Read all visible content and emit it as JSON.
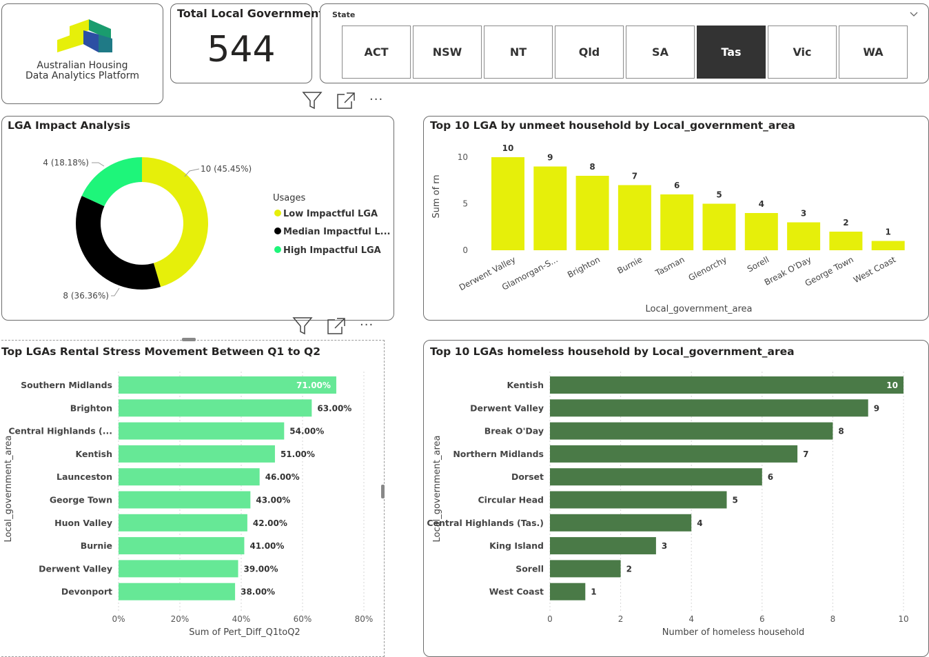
{
  "logo": {
    "line1": "Australian Housing",
    "line2": "Data Analytics Platform"
  },
  "kpi": {
    "title": "Total Local Government",
    "value": "544"
  },
  "slicer": {
    "title": "State",
    "options": [
      "ACT",
      "NSW",
      "NT",
      "Qld",
      "SA",
      "Tas",
      "Vic",
      "WA"
    ],
    "selected": "Tas"
  },
  "icons": [
    "filter-icon",
    "focus-mode-icon",
    "more-options-icon",
    "chevron-down-icon"
  ],
  "donut": {
    "title": "LGA Impact Analysis",
    "legend_title": "Usages",
    "slices": [
      {
        "name": "Low Impactful LGA",
        "value": 10,
        "label": "10 (45.45%)",
        "color": "#e6ef0a"
      },
      {
        "name": "Median Impactful L...",
        "value": 8,
        "label": "8 (36.36%)",
        "color": "#000000"
      },
      {
        "name": "High Impactful LGA",
        "value": 4,
        "label": "4 (18.18%)",
        "color": "#1ef57a"
      }
    ]
  },
  "chart_data": [
    {
      "type": "bar",
      "title": "Top 10 LGA by unmeet household by Local_government_area",
      "xlabel": "Local_government_area",
      "ylabel": "Sum of rn",
      "categories": [
        "Derwent Valley",
        "Glamorgan-S...",
        "Brighton",
        "Burnie",
        "Tasman",
        "Glenorchy",
        "Sorell",
        "Break O'Day",
        "George Town",
        "West Coast"
      ],
      "values": [
        10,
        9,
        8,
        7,
        6,
        5,
        4,
        3,
        2,
        1
      ],
      "yticks": [
        "0",
        "5",
        "10"
      ],
      "ylim": [
        0,
        10
      ],
      "color": "#e6ef0a",
      "grid": false
    },
    {
      "type": "bar",
      "orientation": "horizontal",
      "title": "Top LGAs Rental Stress Movement Between Q1 to Q2",
      "xlabel": "Sum of Pert_Diff_Q1toQ2",
      "ylabel": "Local_government_area",
      "categories": [
        "Southern Midlands",
        "Brighton",
        "Central Highlands (...",
        "Kentish",
        "Launceston",
        "George Town",
        "Huon Valley",
        "Burnie",
        "Derwent Valley",
        "Devonport"
      ],
      "values": [
        71,
        63,
        54,
        51,
        46,
        43,
        42,
        41,
        39,
        38
      ],
      "data_labels": [
        "71.00%",
        "63.00%",
        "54.00%",
        "51.00%",
        "46.00%",
        "43.00%",
        "42.00%",
        "41.00%",
        "39.00%",
        "38.00%"
      ],
      "xticks": [
        "0%",
        "20%",
        "40%",
        "60%",
        "80%"
      ],
      "xlim": [
        0,
        80
      ],
      "color": "#66e896",
      "grid": true
    },
    {
      "type": "bar",
      "orientation": "horizontal",
      "title": "Top 10 LGAs homeless household by Local_government_area",
      "xlabel": "Number of homeless household",
      "ylabel": "Local_government_area",
      "categories": [
        "Kentish",
        "Derwent Valley",
        "Break O'Day",
        "Northern Midlands",
        "Dorset",
        "Circular Head",
        "Central Highlands (Tas.)",
        "King Island",
        "Sorell",
        "West Coast"
      ],
      "values": [
        10,
        9,
        8,
        7,
        6,
        5,
        4,
        3,
        2,
        1
      ],
      "data_labels": [
        "10",
        "9",
        "8",
        "7",
        "6",
        "5",
        "4",
        "3",
        "2",
        "1"
      ],
      "xticks": [
        "0",
        "2",
        "4",
        "6",
        "8",
        "10"
      ],
      "xlim": [
        0,
        10
      ],
      "color": "#4a7a47",
      "grid": true
    }
  ]
}
